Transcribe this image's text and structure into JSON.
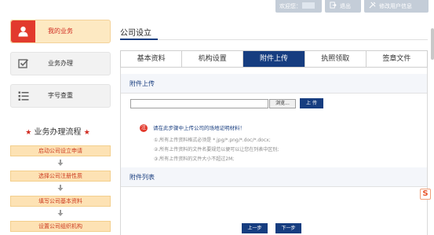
{
  "topbar": {
    "welcome_label": "欢迎您：",
    "logout_label": "退出",
    "edit_user_label": "修改用户信息"
  },
  "sidebar": {
    "items": [
      {
        "label": "我的业务",
        "icon": "user-icon"
      },
      {
        "label": "业务办理",
        "icon": "checkbox-icon"
      },
      {
        "label": "字号查重",
        "icon": "list-icon"
      }
    ],
    "flow_title": "业务办理流程",
    "flow_steps": [
      "启动公司设立申请",
      "选择公司注册性质",
      "填写公司基本资料",
      "设置公司组织机构"
    ]
  },
  "main": {
    "title": "公司设立",
    "tabs": [
      "基本资料",
      "机构设置",
      "附件上传",
      "执照领取",
      "签章文件"
    ],
    "active_tab": "附件上传",
    "upload_section_title": "附件上传",
    "browse_label": "浏览...",
    "upload_label": "上 传",
    "warning": "请在此步骤中上传公司的场地证明材料！",
    "hints": [
      "①.所有上传资料格式必须是 *.jpg/*.png/*.doc/*.docx;",
      "②.所有上传资料的文件名要规范以便可以让您在列表中区别;",
      "③.所有上传资料的文件大小不超过2M;"
    ],
    "attachment_list_title": "附件列表",
    "prev_label": "上一步",
    "next_label": "下一步"
  },
  "colors": {
    "primary_navy": "#163d80",
    "accent_red": "#e23a2d",
    "flow_step_bg": "#fde2b4"
  }
}
